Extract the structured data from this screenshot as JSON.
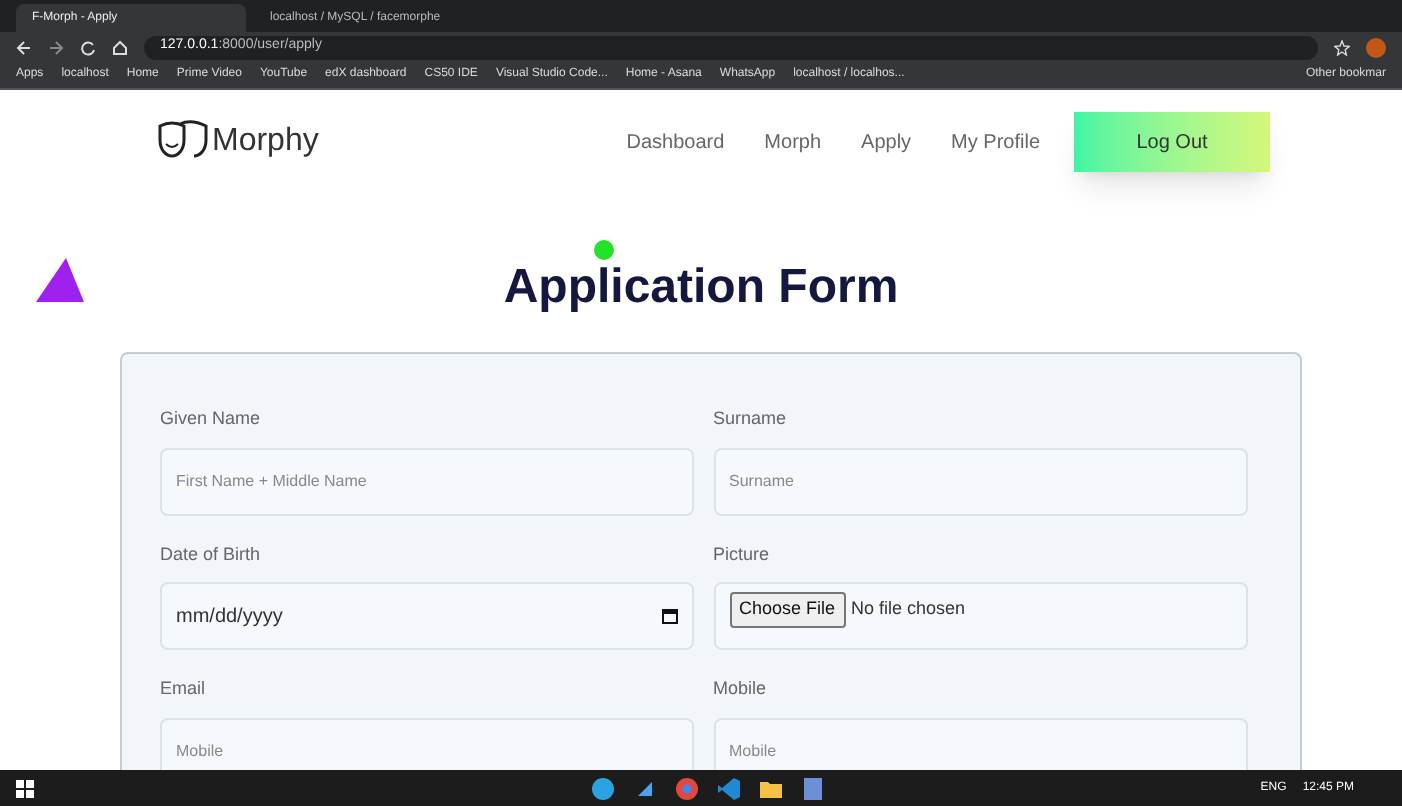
{
  "browser": {
    "tabs": [
      {
        "title": "F-Morph - Apply",
        "selected": true
      },
      {
        "title": "localhost / MySQL / facemorphe",
        "selected": false
      }
    ],
    "address": {
      "host": "127.0.0.1",
      "path": ":8000/user/apply"
    },
    "bookmarks": [
      "Apps",
      "localhost",
      "Home",
      "Prime Video",
      "YouTube",
      "edX dashboard",
      "CS50 IDE",
      "Visual Studio Code...",
      "Home - Asana",
      "WhatsApp",
      "localhost / localhos..."
    ],
    "other_bookmarks": "Other bookmar"
  },
  "site": {
    "logo": "Morphy",
    "nav": [
      {
        "label": "Dashboard",
        "selected": false
      },
      {
        "label": "Morph",
        "selected": false
      },
      {
        "label": "Apply",
        "selected": false
      },
      {
        "label": "My Profile",
        "selected": false
      }
    ],
    "logout": "Log Out"
  },
  "form": {
    "title": "Application Form",
    "fields": [
      {
        "label": "Given Name",
        "kind": "text",
        "placeholder": "First Name + Middle Name"
      },
      {
        "label": "Surname",
        "kind": "text",
        "placeholder": "Surname"
      },
      {
        "label": "Date of Birth",
        "kind": "date",
        "value": "mm/dd/yyyy"
      },
      {
        "label": "Picture",
        "kind": "file",
        "button": "Choose File",
        "value": "No file chosen"
      },
      {
        "label": "Email",
        "kind": "text",
        "placeholder": "Mobile"
      },
      {
        "label": "Mobile",
        "kind": "text",
        "placeholder": "Mobile"
      }
    ]
  },
  "taskbar": {
    "language": "ENG",
    "time": "12:45 PM"
  }
}
